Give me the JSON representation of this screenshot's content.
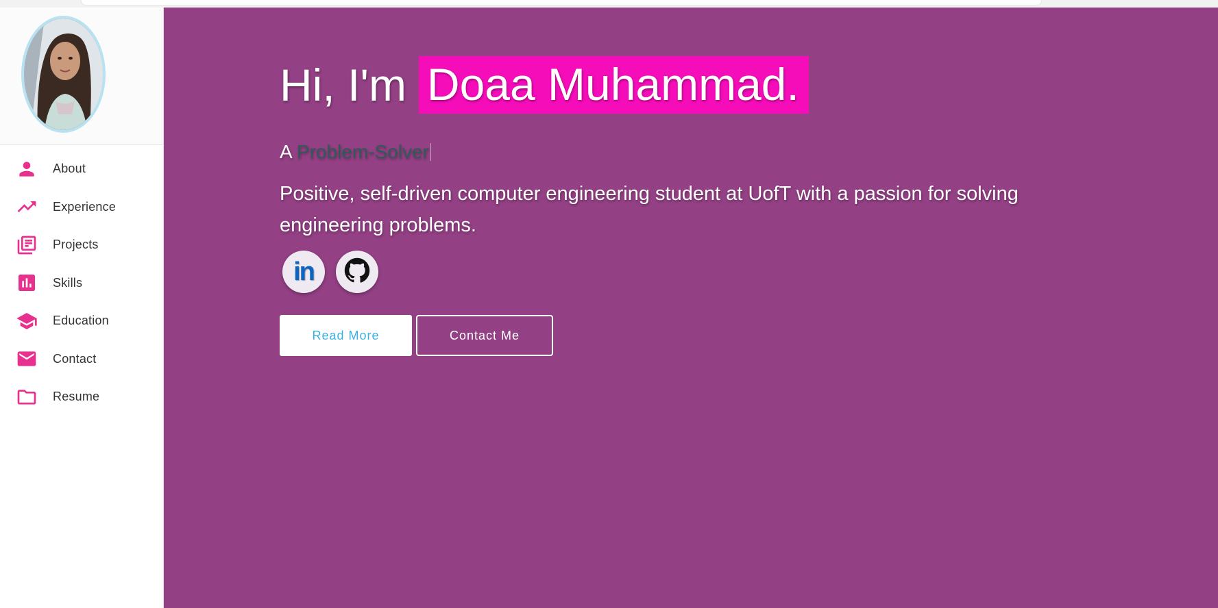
{
  "sidebar": {
    "avatar_alt": "Profile photo",
    "items": [
      {
        "label": "About",
        "icon": "person-icon"
      },
      {
        "label": "Experience",
        "icon": "trending-up-icon"
      },
      {
        "label": "Projects",
        "icon": "library-books-icon"
      },
      {
        "label": "Skills",
        "icon": "bar-chart-icon"
      },
      {
        "label": "Education",
        "icon": "graduation-cap-icon"
      },
      {
        "label": "Contact",
        "icon": "mail-icon"
      },
      {
        "label": "Resume",
        "icon": "folder-icon"
      }
    ],
    "icon_color": "#e8318f"
  },
  "hero": {
    "greeting_prefix": "Hi, I'm",
    "name": "Doaa Muhammad.",
    "tagline_prefix": "A",
    "tagline_role": "Problem-Solver",
    "intro": "Positive, self-driven computer engineering student at UofT with a passion for solving engineering problems.",
    "socials": [
      {
        "name": "LinkedIn",
        "icon": "linkedin-icon",
        "text": "in"
      },
      {
        "name": "GitHub",
        "icon": "github-icon"
      }
    ],
    "primary_button": "Read More",
    "secondary_button": "Contact Me"
  },
  "colors": {
    "background": "#934084",
    "name_highlight": "#f50db9",
    "role_text": "#2f5a56",
    "primary_button_text": "#3ab0e6"
  }
}
